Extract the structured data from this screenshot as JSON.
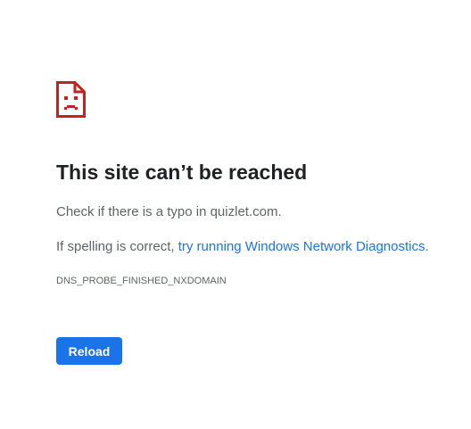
{
  "icon": "sad-page-icon",
  "colors": {
    "icon": "#c5221f",
    "title": "#202124",
    "body": "#5f6368",
    "link": "#1a73e8",
    "button_bg": "#1a73e8",
    "button_text": "#ffffff"
  },
  "main": {
    "title": "This site can’t be reached",
    "suggestion_typo_prefix": "Check if there is a typo in ",
    "domain": "quizlet.com",
    "suggestion_typo_suffix": ".",
    "suggestion_spelling_prefix": "If spelling is correct, ",
    "diagnostics_link": "try running Windows Network Diagnostics",
    "suggestion_spelling_suffix": ".",
    "error_code": "DNS_PROBE_FINISHED_NXDOMAIN"
  },
  "buttons": {
    "reload": "Reload"
  }
}
